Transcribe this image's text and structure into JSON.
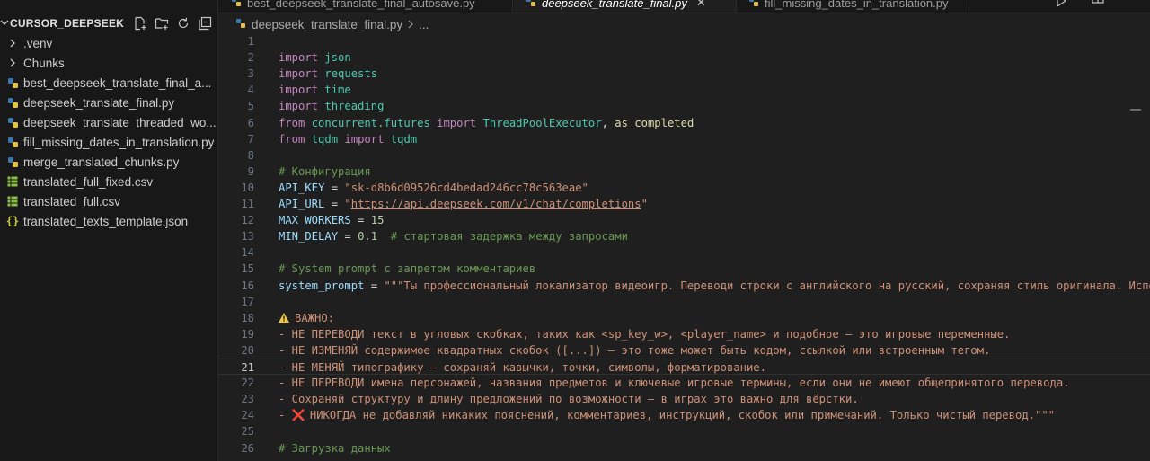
{
  "sidebar": {
    "title": "CURSOR_DEEPSEEK",
    "items": [
      {
        "label": ".venv",
        "icon": "chevron-right-icon",
        "kind": "folder"
      },
      {
        "label": "Chunks",
        "icon": "chevron-right-icon",
        "kind": "folder"
      },
      {
        "label": "best_deepseek_translate_final_a...",
        "icon": "python-icon",
        "kind": "py"
      },
      {
        "label": "deepseek_translate_final.py",
        "icon": "python-icon",
        "kind": "py"
      },
      {
        "label": "deepseek_translate_threaded_wo...",
        "icon": "python-icon",
        "kind": "py"
      },
      {
        "label": "fill_missing_dates_in_translation.py",
        "icon": "python-icon",
        "kind": "py"
      },
      {
        "label": "merge_translated_chunks.py",
        "icon": "python-icon",
        "kind": "py"
      },
      {
        "label": "translated_full_fixed.csv",
        "icon": "csv-icon",
        "kind": "csv"
      },
      {
        "label": "translated_full.csv",
        "icon": "csv-icon",
        "kind": "csv"
      },
      {
        "label": "translated_texts_template.json",
        "icon": "json-icon",
        "kind": "json"
      }
    ]
  },
  "tabs": [
    {
      "label": "best_deepseek_translate_final_autosave.py",
      "active": false
    },
    {
      "label": "deepseek_translate_final.py",
      "active": true
    },
    {
      "label": "fill_missing_dates_in_translation.py",
      "active": false
    }
  ],
  "breadcrumb": {
    "file": "deepseek_translate_final.py",
    "more": "..."
  },
  "editor": {
    "current_line": 21,
    "lines": [
      {
        "n": "1",
        "tokens": []
      },
      {
        "n": "2",
        "tokens": [
          [
            "kw",
            "import"
          ],
          [
            "op",
            " "
          ],
          [
            "mod",
            "json"
          ]
        ]
      },
      {
        "n": "3",
        "tokens": [
          [
            "kw",
            "import"
          ],
          [
            "op",
            " "
          ],
          [
            "mod",
            "requests"
          ]
        ]
      },
      {
        "n": "4",
        "tokens": [
          [
            "kw",
            "import"
          ],
          [
            "op",
            " "
          ],
          [
            "mod",
            "time"
          ]
        ]
      },
      {
        "n": "5",
        "tokens": [
          [
            "kw",
            "import"
          ],
          [
            "op",
            " "
          ],
          [
            "mod",
            "threading"
          ]
        ]
      },
      {
        "n": "6",
        "tokens": [
          [
            "kw",
            "from"
          ],
          [
            "op",
            " "
          ],
          [
            "mod",
            "concurrent.futures"
          ],
          [
            "op",
            " "
          ],
          [
            "kw",
            "import"
          ],
          [
            "op",
            " "
          ],
          [
            "mod",
            "ThreadPoolExecutor"
          ],
          [
            "op",
            ", "
          ],
          [
            "fn",
            "as_completed"
          ]
        ]
      },
      {
        "n": "7",
        "tokens": [
          [
            "kw",
            "from"
          ],
          [
            "op",
            " "
          ],
          [
            "mod",
            "tqdm"
          ],
          [
            "op",
            " "
          ],
          [
            "kw",
            "import"
          ],
          [
            "op",
            " "
          ],
          [
            "mod",
            "tqdm"
          ]
        ]
      },
      {
        "n": "8",
        "tokens": []
      },
      {
        "n": "9",
        "tokens": [
          [
            "cmt",
            "# Конфигурация"
          ]
        ]
      },
      {
        "n": "10",
        "tokens": [
          [
            "var",
            "API_KEY"
          ],
          [
            "op",
            " = "
          ],
          [
            "str",
            "\"sk-d8b6d09526cd4bedad246cc78c563eae\""
          ]
        ]
      },
      {
        "n": "11",
        "tokens": [
          [
            "var",
            "API_URL"
          ],
          [
            "op",
            " = "
          ],
          [
            "str",
            "\""
          ],
          [
            "str url",
            "https://api.deepseek.com/v1/chat/completions"
          ],
          [
            "str",
            "\""
          ]
        ]
      },
      {
        "n": "12",
        "tokens": [
          [
            "var",
            "MAX_WORKERS"
          ],
          [
            "op",
            " = "
          ],
          [
            "num",
            "15"
          ]
        ]
      },
      {
        "n": "13",
        "tokens": [
          [
            "var",
            "MIN_DELAY"
          ],
          [
            "op",
            " = "
          ],
          [
            "num",
            "0.1"
          ],
          [
            "op",
            "  "
          ],
          [
            "cmt",
            "# стартовая задержка между запросами"
          ]
        ]
      },
      {
        "n": "14",
        "tokens": []
      },
      {
        "n": "15",
        "tokens": [
          [
            "cmt",
            "# System prompt с запретом комментариев"
          ]
        ]
      },
      {
        "n": "16",
        "tokens": [
          [
            "var",
            "system_prompt"
          ],
          [
            "op",
            " = "
          ],
          [
            "str",
            "\"\"\"Ты профессиональный локализатор видеоигр. Переводи строки с английского на русский, сохраняя стиль оригинала. Испо"
          ]
        ]
      },
      {
        "n": "17",
        "tokens": []
      },
      {
        "n": "18",
        "tokens": [
          [
            "warn",
            ""
          ],
          [
            "str",
            "ВАЖНО:"
          ]
        ]
      },
      {
        "n": "19",
        "tokens": [
          [
            "str",
            "- НЕ ПЕРЕВОДИ текст в угловых скобках, таких как <sp_key_w>, <player_name> и подобное — это игровые переменные."
          ]
        ]
      },
      {
        "n": "20",
        "tokens": [
          [
            "str",
            "- НЕ ИЗМЕНЯЙ содержимое квадратных скобок ([...]) — это тоже может быть кодом, ссылкой или встроенным тегом."
          ]
        ]
      },
      {
        "n": "21",
        "tokens": [
          [
            "str",
            "- НЕ МЕНЯЙ типографику — сохраняй кавычки, точки, символы, форматирование."
          ]
        ]
      },
      {
        "n": "22",
        "tokens": [
          [
            "str",
            "- НЕ ПЕРЕВОДИ имена персонажей, названия предметов и ключевые игровые термины, если они не имеют общепринятого перевода."
          ]
        ]
      },
      {
        "n": "23",
        "tokens": [
          [
            "str",
            "- Сохраняй структуру и длину предложений по возможности — в играх это важно для вёрстки."
          ]
        ]
      },
      {
        "n": "24",
        "tokens": [
          [
            "str",
            "- "
          ],
          [
            "redx",
            "❌"
          ],
          [
            "str",
            "НИКОГДА не добавляй никаких пояснений, комментариев, инструкций, скобок или примечаний. Только чистый перевод.\"\"\""
          ]
        ]
      },
      {
        "n": "25",
        "tokens": []
      },
      {
        "n": "26",
        "tokens": [
          [
            "cmt",
            "# Загрузка данных"
          ]
        ]
      }
    ]
  }
}
